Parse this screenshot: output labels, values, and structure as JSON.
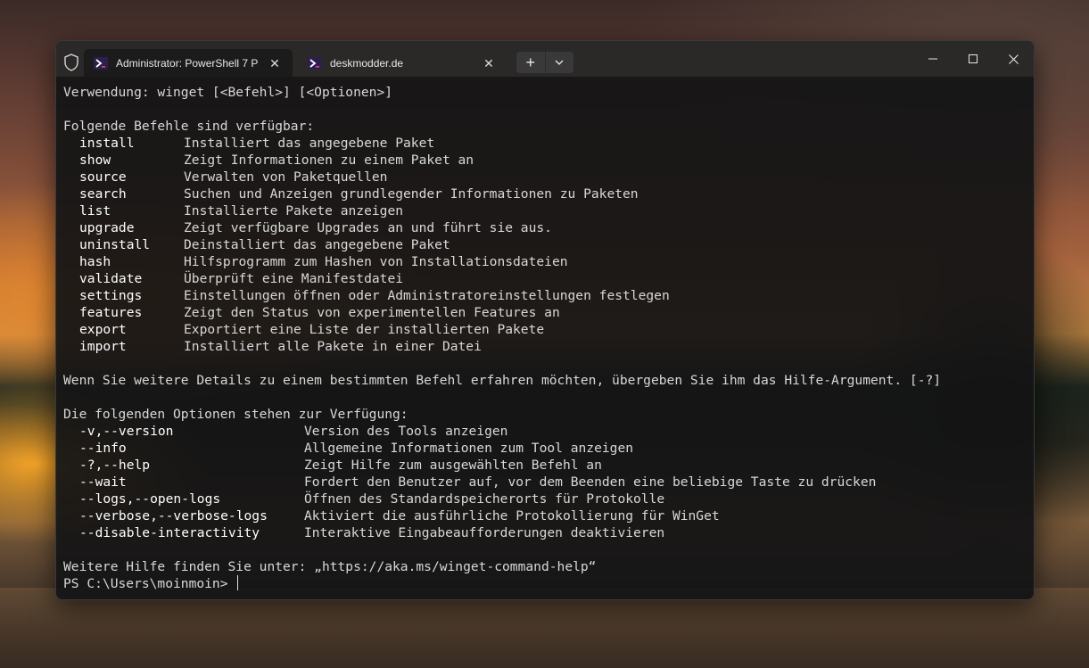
{
  "window": {
    "tabs": [
      {
        "label": "Administrator: PowerShell 7 P",
        "icon": "powershell-icon",
        "active": true
      },
      {
        "label": "deskmodder.de",
        "icon": "powershell-icon",
        "active": false
      }
    ],
    "new_tab_label": "+",
    "accent_color": "#7b2bd6"
  },
  "terminal": {
    "usage": "Verwendung: winget [<Befehl>] [<Optionen>]",
    "commands_header": "Folgende Befehle sind verfügbar:",
    "commands": [
      {
        "name": "install",
        "desc": "Installiert das angegebene Paket"
      },
      {
        "name": "show",
        "desc": "Zeigt Informationen zu einem Paket an"
      },
      {
        "name": "source",
        "desc": "Verwalten von Paketquellen"
      },
      {
        "name": "search",
        "desc": "Suchen und Anzeigen grundlegender Informationen zu Paketen"
      },
      {
        "name": "list",
        "desc": "Installierte Pakete anzeigen"
      },
      {
        "name": "upgrade",
        "desc": "Zeigt verfügbare Upgrades an und führt sie aus."
      },
      {
        "name": "uninstall",
        "desc": "Deinstalliert das angegebene Paket"
      },
      {
        "name": "hash",
        "desc": "Hilfsprogramm zum Hashen von Installationsdateien"
      },
      {
        "name": "validate",
        "desc": "Überprüft eine Manifestdatei"
      },
      {
        "name": "settings",
        "desc": "Einstellungen öffnen oder Administratoreinstellungen festlegen"
      },
      {
        "name": "features",
        "desc": "Zeigt den Status von experimentellen Features an"
      },
      {
        "name": "export",
        "desc": "Exportiert eine Liste der installierten Pakete"
      },
      {
        "name": "import",
        "desc": "Installiert alle Pakete in einer Datei"
      }
    ],
    "details_note": "Wenn Sie weitere Details zu einem bestimmten Befehl erfahren möchten, übergeben Sie ihm das Hilfe-Argument. [-?]",
    "options_header": "Die folgenden Optionen stehen zur Verfügung:",
    "options": [
      {
        "name": "-v,--version",
        "desc": "Version des Tools anzeigen"
      },
      {
        "name": "--info",
        "desc": "Allgemeine Informationen zum Tool anzeigen"
      },
      {
        "name": "-?,--help",
        "desc": "Zeigt Hilfe zum ausgewählten Befehl an"
      },
      {
        "name": "--wait",
        "desc": "Fordert den Benutzer auf, vor dem Beenden eine beliebige Taste zu drücken"
      },
      {
        "name": "--logs,--open-logs",
        "desc": "Öffnen des Standardspeicherorts für Protokolle"
      },
      {
        "name": "--verbose,--verbose-logs",
        "desc": "Aktiviert die ausführliche Protokollierung für WinGet"
      },
      {
        "name": "--disable-interactivity",
        "desc": "Interaktive Eingabeaufforderungen deaktivieren"
      }
    ],
    "more_help": "Weitere Hilfe finden Sie unter: „https://aka.ms/winget-command-help“",
    "prompt": "PS C:\\Users\\moinmoin> "
  }
}
